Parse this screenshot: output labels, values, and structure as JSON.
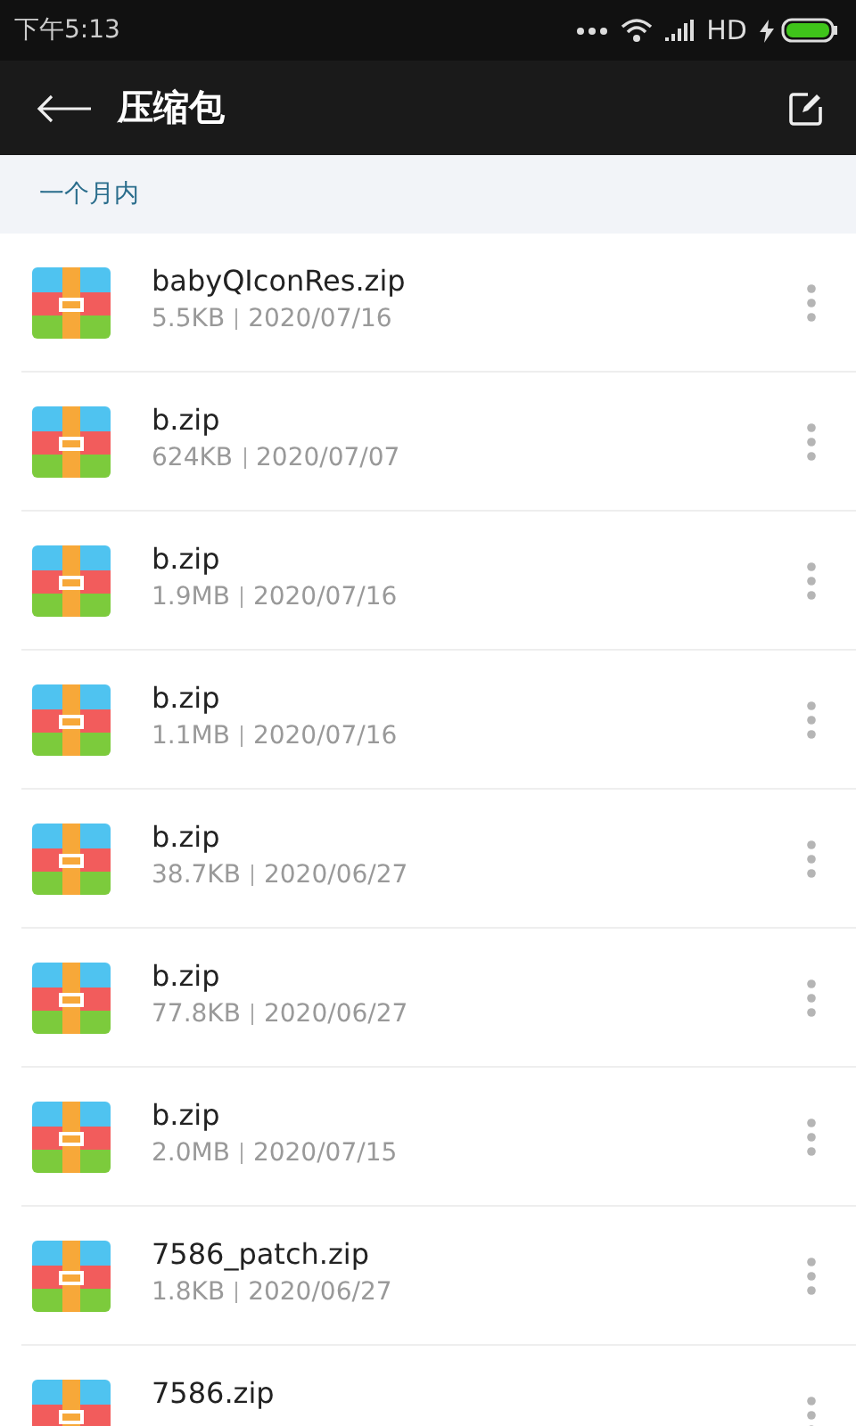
{
  "status_bar": {
    "time": "下午5:13",
    "network": "HD"
  },
  "header": {
    "title": "压缩包"
  },
  "section": {
    "title": "一个月内"
  },
  "files": [
    {
      "name": "babyQIconRes.zip",
      "size": "5.5KB",
      "date": "2020/07/16"
    },
    {
      "name": "b.zip",
      "size": "624KB",
      "date": "2020/07/07"
    },
    {
      "name": "b.zip",
      "size": "1.9MB",
      "date": "2020/07/16"
    },
    {
      "name": "b.zip",
      "size": "1.1MB",
      "date": "2020/07/16"
    },
    {
      "name": "b.zip",
      "size": "38.7KB",
      "date": "2020/06/27"
    },
    {
      "name": "b.zip",
      "size": "77.8KB",
      "date": "2020/06/27"
    },
    {
      "name": "b.zip",
      "size": "2.0MB",
      "date": "2020/07/15"
    },
    {
      "name": "7586_patch.zip",
      "size": "1.8KB",
      "date": "2020/06/27"
    },
    {
      "name": "7586.zip"
    }
  ]
}
